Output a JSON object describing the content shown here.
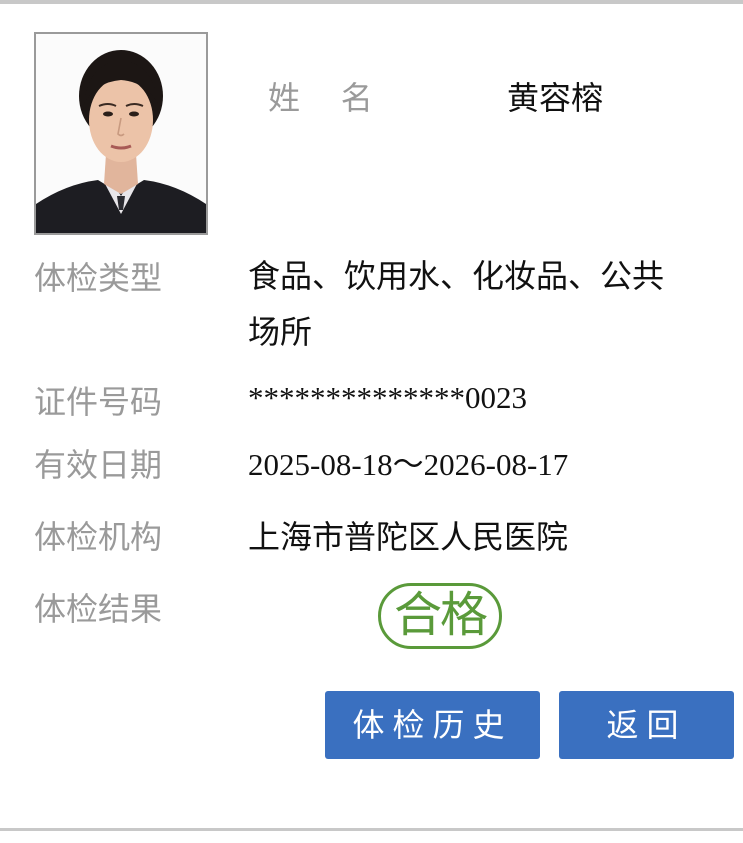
{
  "profile": {
    "name_label": "姓    名",
    "name_value": "黄容榕"
  },
  "fields": {
    "type_label": "体检类型",
    "type_value": "食品、饮用水、化妆品、公共场所",
    "id_label": "证件号码",
    "id_value": "**************0023",
    "validity_label": "有效日期",
    "validity_value": "2025-08-18～2026-08-17",
    "institution_label": "体检机构",
    "institution_value": "上海市普陀区人民医院",
    "result_label": "体检结果",
    "result_value": "合格"
  },
  "actions": {
    "history_label": "体检历史",
    "back_label": "返回"
  },
  "colors": {
    "label_gray": "#9a9a9a",
    "stamp_green": "#5a9a3a",
    "button_blue": "#3a70c0"
  }
}
